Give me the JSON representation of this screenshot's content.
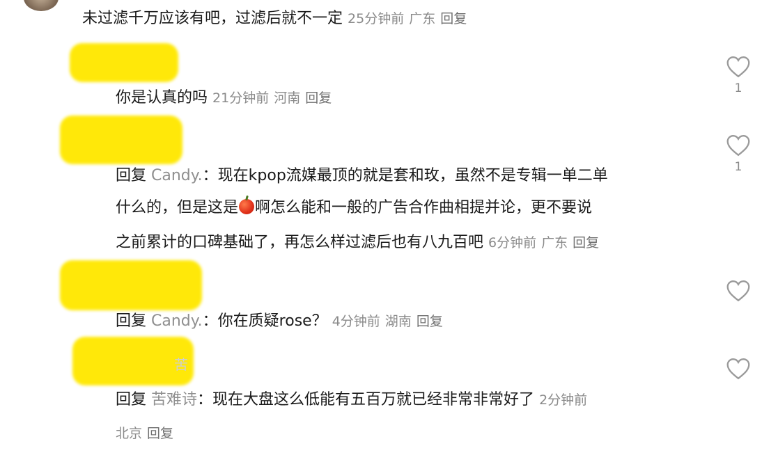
{
  "comments": [
    {
      "text": "未过滤千万应该有吧，过滤后就不一定",
      "time": "25分钟前",
      "location": "广东",
      "reply_label": "回复"
    },
    {
      "text": "你是认真的吗",
      "time": "21分钟前",
      "location": "河南",
      "reply_label": "回复",
      "likes": "1"
    },
    {
      "prefix": "回复",
      "mention": "Candy.",
      "colon": "：",
      "lines": [
        "现在kpop流媒最顶的就是套和玫，虽然不是专辑一单二单",
        "什么的，但是这是",
        "啊怎么能和一般的广告合作曲相提并论，更不要说",
        "之前累计的口碑基础了，再怎么样过滤后也有八九百吧"
      ],
      "time": "6分钟前",
      "location": "广东",
      "reply_label": "回复",
      "likes": "1"
    },
    {
      "prefix": "回复",
      "mention": "Candy.",
      "colon": "：",
      "text": "你在质疑rose？",
      "time": "4分钟前",
      "location": "湖南",
      "reply_label": "回复"
    },
    {
      "prefix": "回复",
      "mention": "苦难诗",
      "colon": "：",
      "text": "现在大盘这么低能有五百万就已经非常非常好了",
      "time": "2分钟前",
      "location": "北京",
      "reply_label": "回复",
      "faint_name_char": "苦"
    }
  ],
  "colors": {
    "redaction": "#ffe800",
    "meta": "#8a8a8a",
    "text": "#1a1a1a"
  },
  "icons": {
    "like": "heart-outline-icon",
    "emoji": "red-apple-emoji"
  }
}
